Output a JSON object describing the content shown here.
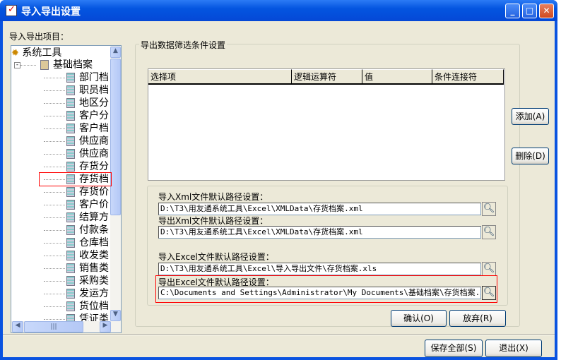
{
  "window": {
    "title": "导入导出设置",
    "min": "_",
    "max": "□",
    "close": "✕"
  },
  "left": {
    "label": "导入导出项目：",
    "root": "系统工具",
    "group": "基础档案",
    "items": [
      "部门档",
      "职员档",
      "地区分",
      "客户分",
      "客户档",
      "供应商",
      "供应商",
      "存货分",
      "存货档",
      "存货价",
      "客户价",
      "结算方",
      "付款条",
      "仓库档",
      "收发类",
      "销售类",
      "采购类",
      "发运方",
      "货位档",
      "凭证类"
    ],
    "selected_index": 8
  },
  "filter": {
    "title": "导出数据筛选条件设置",
    "columns": [
      "选择项",
      "逻辑运算符",
      "值",
      "条件连接符"
    ],
    "add": "添加(A)",
    "delete": "删除(D)"
  },
  "paths": {
    "import_xml_label": "导入Xml文件默认路径设置：",
    "import_xml": "D:\\T3\\用友通系统工具\\Excel\\XMLData\\存货档案.xml",
    "export_xml_label": "导出Xml文件默认路径设置：",
    "export_xml": "D:\\T3\\用友通系统工具\\Excel\\XMLData\\存货档案.xml",
    "import_excel_label": "导入Excel文件默认路径设置：",
    "import_excel": "D:\\T3\\用友通系统工具\\Excel\\导入导出文件\\存货档案.xls",
    "export_excel_label": "导出Excel文件默认路径设置：",
    "export_excel": "C:\\Documents and Settings\\Administrator\\My Documents\\基础档案\\存货档案.xls"
  },
  "buttons": {
    "confirm": "确认(O)",
    "discard": "放弃(R)",
    "save_all": "保存全部(S)",
    "exit": "退出(X)"
  }
}
